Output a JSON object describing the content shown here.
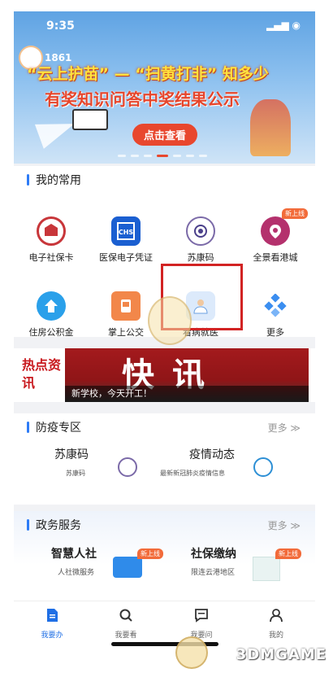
{
  "status": {
    "time": "9:35"
  },
  "banner": {
    "tag": "1861",
    "title": "“云上护苗” — “扫黄打非” 知多少",
    "subtitle": "有奖知识问答中奖结果公示",
    "cta": "点击查看"
  },
  "favorites": {
    "title": "我的常用",
    "items": [
      {
        "label": "电子社保卡",
        "icon": "social-security-card-icon"
      },
      {
        "label": "医保电子凭证",
        "icon": "chs-medical-insurance-icon"
      },
      {
        "label": "苏康码",
        "icon": "sukang-code-icon"
      },
      {
        "label": "全景看港城",
        "icon": "panorama-city-icon",
        "badge": "新上线"
      },
      {
        "label": "住房公积金",
        "icon": "housing-fund-icon"
      },
      {
        "label": "掌上公交",
        "icon": "mobile-bus-icon"
      },
      {
        "label": "看病就医",
        "icon": "doctor-visit-icon"
      },
      {
        "label": "更多",
        "icon": "more-apps-icon"
      }
    ]
  },
  "news": {
    "label": "热点资讯",
    "headline": "快讯",
    "caption": "新学校，今天开工！"
  },
  "epidemic": {
    "title": "防疫专区",
    "more": "更多",
    "items": [
      {
        "title": "苏康码",
        "subtitle": "苏康码"
      },
      {
        "title": "疫情动态",
        "subtitle": "最新新冠肺炎疫情信息"
      }
    ]
  },
  "gov": {
    "title": "政务服务",
    "more": "更多",
    "items": [
      {
        "title": "智慧人社",
        "subtitle": "人社微服务",
        "badge": "新上线"
      },
      {
        "title": "社保缴纳",
        "subtitle": "限连云港地区",
        "badge": "新上线"
      }
    ]
  },
  "tabs": [
    {
      "label": "我要办",
      "active": true
    },
    {
      "label": "我要看",
      "active": false
    },
    {
      "label": "我要问",
      "active": false
    },
    {
      "label": "我的",
      "active": false
    }
  ],
  "watermark": "3DMGAME",
  "colors": {
    "accent": "#2e7cf6",
    "highlight": "#d22323",
    "news_red": "#c8191e",
    "badge": "#f26b3a"
  }
}
